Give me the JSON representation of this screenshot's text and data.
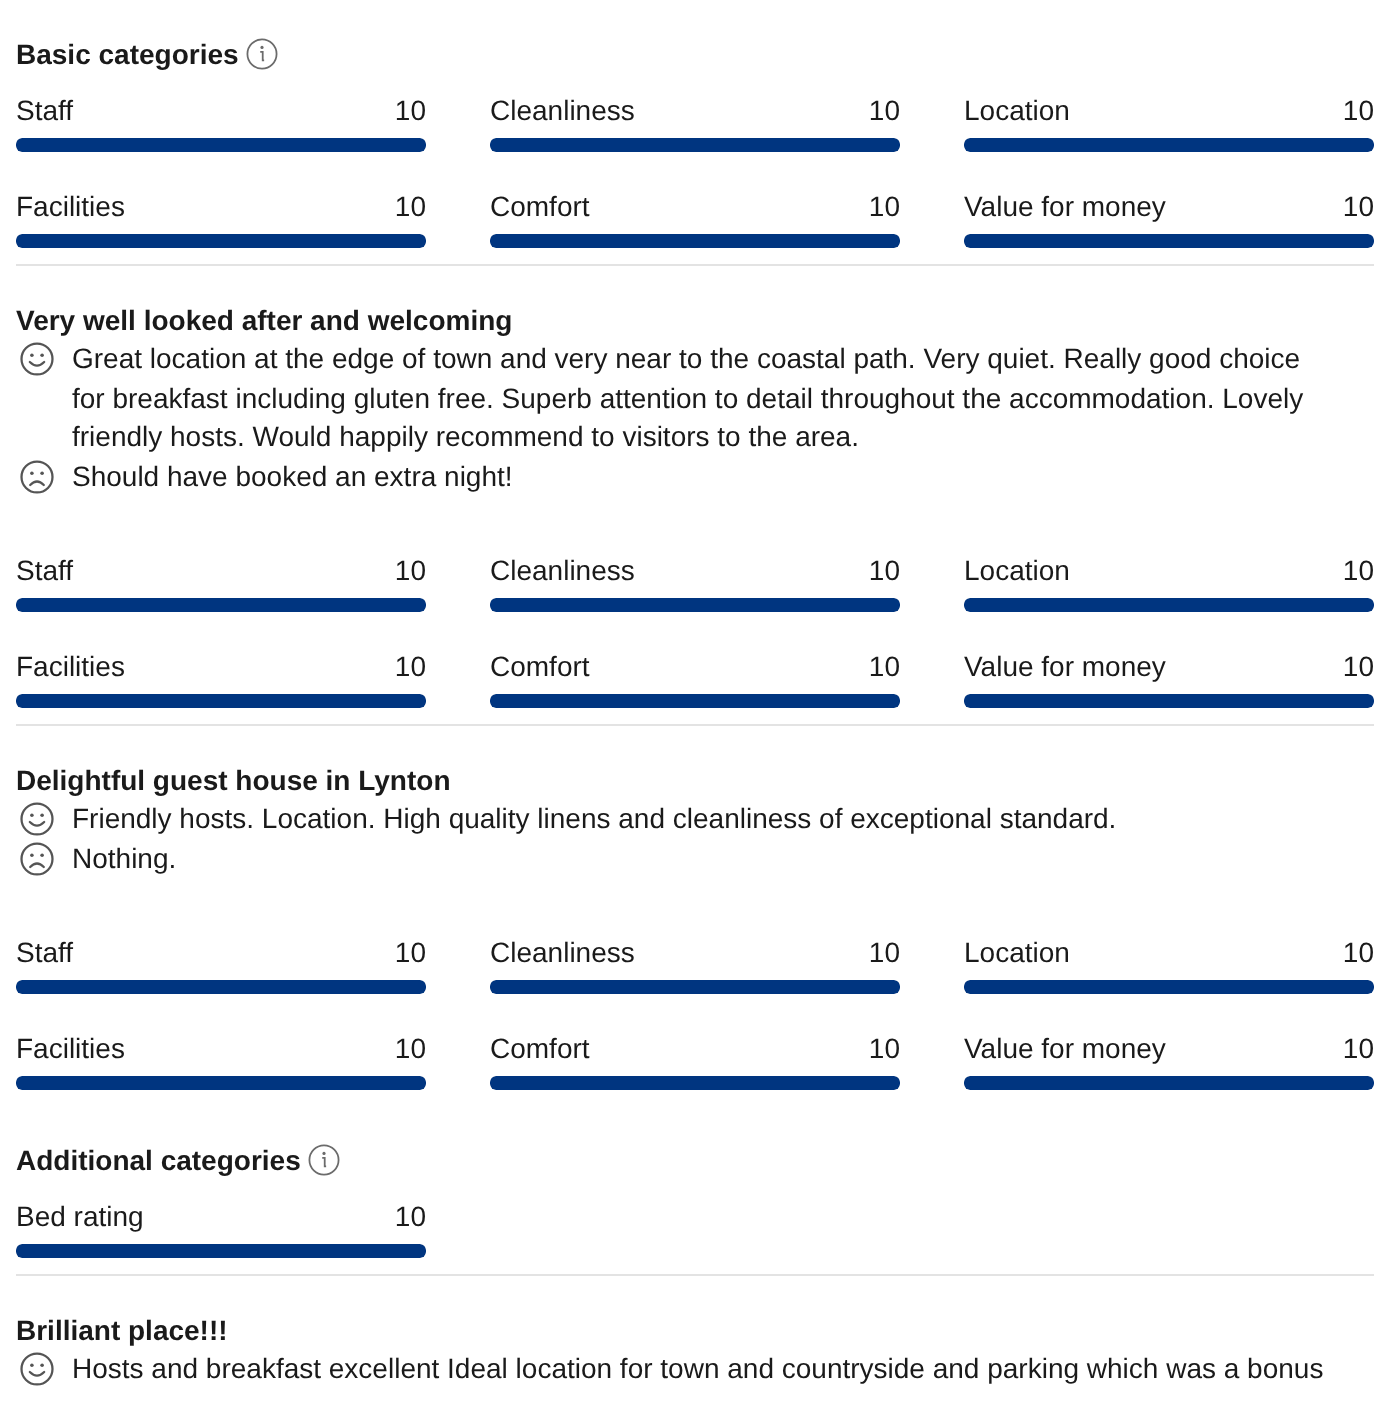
{
  "reviews": [
    {
      "category_groups": [
        {
          "heading": "Basic categories",
          "scores": [
            {
              "label": "Staff",
              "value": "10",
              "level": 1
            },
            {
              "label": "Cleanliness",
              "value": "10",
              "level": 1
            },
            {
              "label": "Location",
              "value": "10",
              "level": 1
            },
            {
              "label": "Facilities",
              "value": "10",
              "level": 1
            },
            {
              "label": "Comfort",
              "value": "10",
              "level": 1
            },
            {
              "label": "Value for money",
              "value": "10",
              "level": 1
            }
          ]
        }
      ]
    },
    {
      "title": "Very well looked after and welcoming",
      "comments": [
        {
          "kind": "positive",
          "text": "Great location at the edge of town and very near to the coastal path. Very quiet. Really good choice for breakfast including gluten free. Superb attention to detail throughout the accommodation. Lovely friendly hosts. Would happily recommend to visitors to the area."
        },
        {
          "kind": "negative",
          "text": "Should have booked an extra night!"
        }
      ],
      "category_groups": [
        {
          "scores": [
            {
              "label": "Staff",
              "value": "10",
              "level": 1
            },
            {
              "label": "Cleanliness",
              "value": "10",
              "level": 1
            },
            {
              "label": "Location",
              "value": "10",
              "level": 1
            },
            {
              "label": "Facilities",
              "value": "10",
              "level": 1
            },
            {
              "label": "Comfort",
              "value": "10",
              "level": 1
            },
            {
              "label": "Value for money",
              "value": "10",
              "level": 1
            }
          ]
        }
      ]
    },
    {
      "title": "Delightful guest house in Lynton",
      "comments": [
        {
          "kind": "positive",
          "text": "Friendly hosts. Location. High quality linens and cleanliness of exceptional standard."
        },
        {
          "kind": "negative",
          "text": "Nothing."
        }
      ],
      "category_groups": [
        {
          "scores": [
            {
              "label": "Staff",
              "value": "10",
              "level": 1
            },
            {
              "label": "Cleanliness",
              "value": "10",
              "level": 1
            },
            {
              "label": "Location",
              "value": "10",
              "level": 1
            },
            {
              "label": "Facilities",
              "value": "10",
              "level": 1
            },
            {
              "label": "Comfort",
              "value": "10",
              "level": 1
            },
            {
              "label": "Value for money",
              "value": "10",
              "level": 1
            }
          ]
        },
        {
          "heading": "Additional categories",
          "scores": [
            {
              "label": "Bed rating",
              "value": "10",
              "level": 1
            }
          ]
        }
      ]
    },
    {
      "title": "Brilliant place!!!",
      "comments": [
        {
          "kind": "positive",
          "text": "Hosts and breakfast excellent Ideal location for town and countryside and parking which was a bonus"
        }
      ]
    }
  ]
}
